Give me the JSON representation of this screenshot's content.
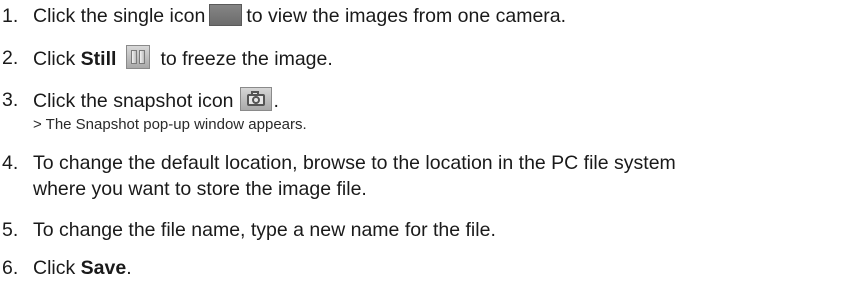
{
  "steps": [
    {
      "number": "1.",
      "before_icon": "Click the single icon",
      "icon": "single-view-icon",
      "after_icon": "to view the images from one camera."
    },
    {
      "number": "2.",
      "lead": "Click ",
      "bold": "Still",
      "icon": "still-icon",
      "after_icon": "to freeze the image."
    },
    {
      "number": "3.",
      "before_icon": "Click the snapshot icon",
      "icon": "camera-icon",
      "after_icon": ".",
      "result": "> The Snapshot pop-up window appears."
    },
    {
      "number": "4.",
      "line1": "To change the default location, browse to the location in the PC file system",
      "line2": "where you want to store the image file."
    },
    {
      "number": "5.",
      "text": "To change the file name, type a new name for the file."
    },
    {
      "number": "6.",
      "lead": "Click ",
      "bold": "Save",
      "tail": "."
    }
  ],
  "colors": {
    "text": "#1a1a1a",
    "icon_single": "#7a7a7a",
    "icon_light": "#c0c0c0"
  }
}
